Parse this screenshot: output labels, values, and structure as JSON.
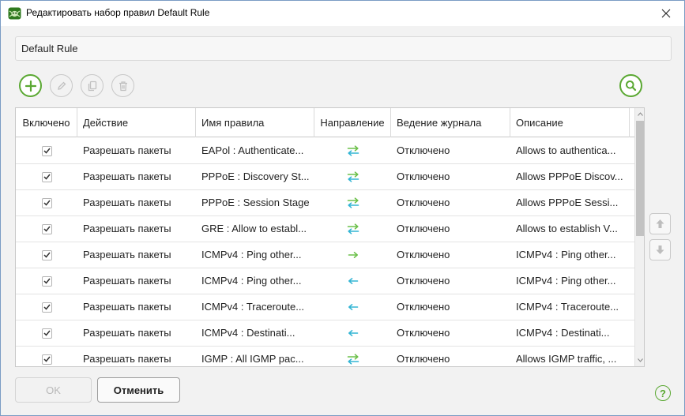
{
  "window": {
    "title": "Редактировать набор правил Default Rule",
    "icon": "dr-web-spider-icon"
  },
  "rule_set_name": "Default Rule",
  "toolbar": {
    "add": {
      "icon": "plus-icon",
      "enabled": true
    },
    "edit": {
      "icon": "pencil-icon",
      "enabled": false
    },
    "copy": {
      "icon": "copy-icon",
      "enabled": false
    },
    "delete": {
      "icon": "trash-icon",
      "enabled": false
    },
    "search": {
      "icon": "search-icon",
      "enabled": true
    }
  },
  "table": {
    "columns": [
      {
        "key": "enabled",
        "label": "Включено"
      },
      {
        "key": "action",
        "label": "Действие"
      },
      {
        "key": "name",
        "label": "Имя правила"
      },
      {
        "key": "direction",
        "label": "Направление"
      },
      {
        "key": "logging",
        "label": "Ведение журнала"
      },
      {
        "key": "description",
        "label": "Описание"
      }
    ],
    "rows": [
      {
        "enabled": true,
        "action": "Разрешать пакеты",
        "name": "EAPol : Authenticate...",
        "direction": "both",
        "logging": "Отключено",
        "description": "Allows to authentica..."
      },
      {
        "enabled": true,
        "action": "Разрешать пакеты",
        "name": "PPPoE : Discovery St...",
        "direction": "both",
        "logging": "Отключено",
        "description": "Allows PPPoE Discov..."
      },
      {
        "enabled": true,
        "action": "Разрешать пакеты",
        "name": "PPPoE : Session Stage",
        "direction": "both",
        "logging": "Отключено",
        "description": "Allows PPPoE Sessi..."
      },
      {
        "enabled": true,
        "action": "Разрешать пакеты",
        "name": "GRE : Allow to establ...",
        "direction": "both",
        "logging": "Отключено",
        "description": "Allows to establish V..."
      },
      {
        "enabled": true,
        "action": "Разрешать пакеты",
        "name": "ICMPv4 : Ping other...",
        "direction": "out",
        "logging": "Отключено",
        "description": "ICMPv4 : Ping other..."
      },
      {
        "enabled": true,
        "action": "Разрешать пакеты",
        "name": "ICMPv4 : Ping other...",
        "direction": "in",
        "logging": "Отключено",
        "description": "ICMPv4 : Ping other..."
      },
      {
        "enabled": true,
        "action": "Разрешать пакеты",
        "name": "ICMPv4 : Traceroute...",
        "direction": "in",
        "logging": "Отключено",
        "description": "ICMPv4 : Traceroute..."
      },
      {
        "enabled": true,
        "action": "Разрешать пакеты",
        "name": "ICMPv4 : Destinati...",
        "direction": "in",
        "logging": "Отключено",
        "description": "ICMPv4 : Destinati..."
      },
      {
        "enabled": true,
        "action": "Разрешать пакеты",
        "name": "IGMP : All IGMP pac...",
        "direction": "both",
        "logging": "Отключено",
        "description": "Allows IGMP traffic, ..."
      }
    ]
  },
  "move_buttons": {
    "up_icon": "arrow-up-icon",
    "down_icon": "arrow-down-icon"
  },
  "buttons": {
    "ok": {
      "label": "OK",
      "enabled": false
    },
    "cancel": {
      "label": "Отменить",
      "enabled": true
    }
  },
  "help": {
    "label": "?",
    "icon": "help-icon"
  },
  "colors": {
    "accent_green": "#5aa832",
    "arrow_out": "#6cc04a",
    "arrow_in": "#33b5d4"
  }
}
